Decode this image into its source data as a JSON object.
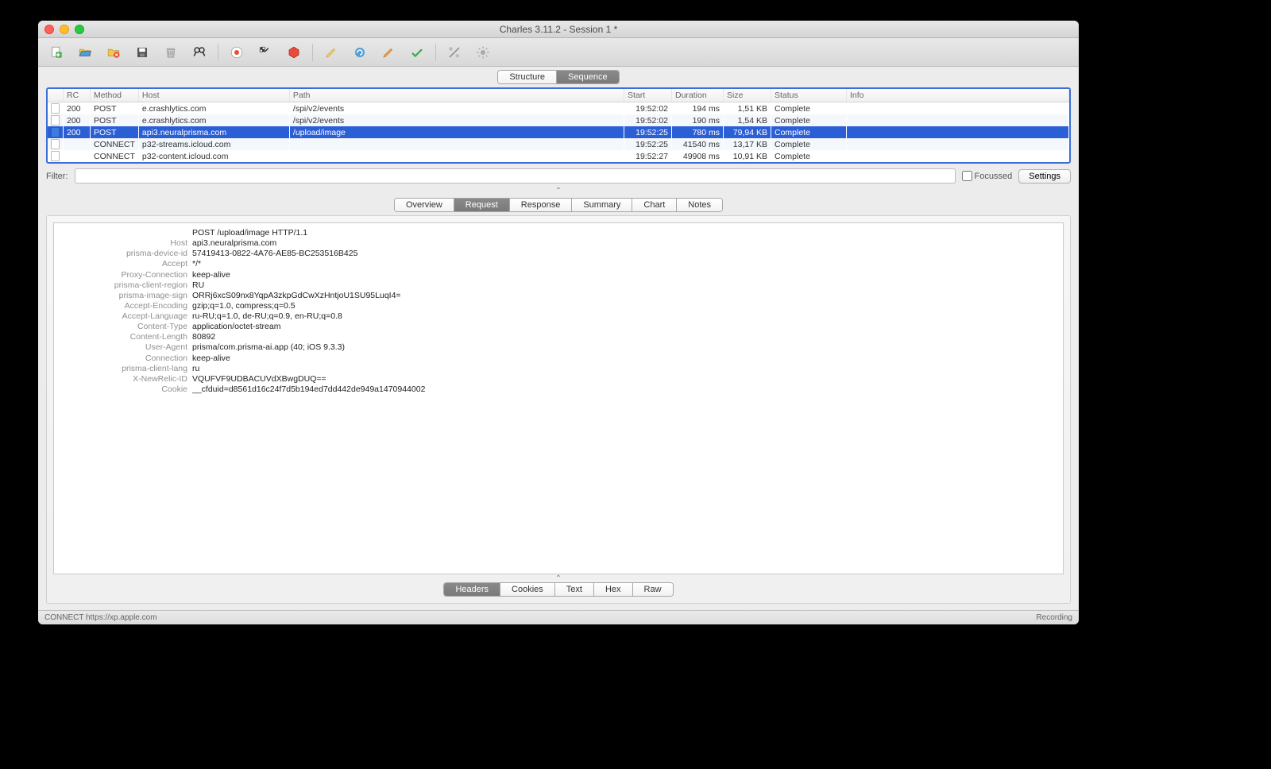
{
  "window": {
    "title": "Charles 3.11.2 - Session 1 *"
  },
  "view_tabs": {
    "structure": "Structure",
    "sequence": "Sequence",
    "active": "sequence"
  },
  "columns": [
    "",
    "RC",
    "Method",
    "Host",
    "Path",
    "Start",
    "Duration",
    "Size",
    "Status",
    "Info"
  ],
  "rows": [
    {
      "icon": "doc",
      "rc": "200",
      "method": "POST",
      "host": "e.crashlytics.com",
      "path": "/spi/v2/events",
      "start": "19:52:02",
      "duration": "194 ms",
      "size": "1,51 KB",
      "status": "Complete",
      "info": ""
    },
    {
      "icon": "doc",
      "rc": "200",
      "method": "POST",
      "host": "e.crashlytics.com",
      "path": "/spi/v2/events",
      "start": "19:52:02",
      "duration": "190 ms",
      "size": "1,54 KB",
      "status": "Complete",
      "info": ""
    },
    {
      "icon": "doc-blue",
      "rc": "200",
      "method": "POST",
      "host": "api3.neuralprisma.com",
      "path": "/upload/image",
      "start": "19:52:25",
      "duration": "780 ms",
      "size": "79,94 KB",
      "status": "Complete",
      "info": "",
      "selected": true
    },
    {
      "icon": "doc-white",
      "rc": "",
      "method": "CONNECT",
      "host": "p32-streams.icloud.com",
      "path": "",
      "start": "19:52:25",
      "duration": "41540 ms",
      "size": "13,17 KB",
      "status": "Complete",
      "info": ""
    },
    {
      "icon": "doc-white",
      "rc": "",
      "method": "CONNECT",
      "host": "p32-content.icloud.com",
      "path": "",
      "start": "19:52:27",
      "duration": "49908 ms",
      "size": "10,91 KB",
      "status": "Complete",
      "info": ""
    }
  ],
  "filter": {
    "label": "Filter:",
    "value": "",
    "focussed_label": "Focussed",
    "settings_label": "Settings"
  },
  "detail_tabs": {
    "overview": "Overview",
    "request": "Request",
    "response": "Response",
    "summary": "Summary",
    "chart": "Chart",
    "notes": "Notes",
    "active": "request"
  },
  "request_line": "POST /upload/image HTTP/1.1",
  "headers": [
    {
      "k": "Host",
      "v": "api3.neuralprisma.com"
    },
    {
      "k": "prisma-device-id",
      "v": "57419413-0822-4A76-AE85-BC253516B425"
    },
    {
      "k": "Accept",
      "v": "*/*"
    },
    {
      "k": "Proxy-Connection",
      "v": "keep-alive"
    },
    {
      "k": "prisma-client-region",
      "v": "RU"
    },
    {
      "k": "prisma-image-sign",
      "v": "ORRj6xcS09nx8YqpA3zkpGdCwXzHntjoU1SU95LuqI4="
    },
    {
      "k": "Accept-Encoding",
      "v": "gzip;q=1.0, compress;q=0.5"
    },
    {
      "k": "Accept-Language",
      "v": "ru-RU;q=1.0, de-RU;q=0.9, en-RU;q=0.8"
    },
    {
      "k": "Content-Type",
      "v": "application/octet-stream"
    },
    {
      "k": "Content-Length",
      "v": "80892"
    },
    {
      "k": "User-Agent",
      "v": "prisma/com.prisma-ai.app (40; iOS 9.3.3)"
    },
    {
      "k": "Connection",
      "v": "keep-alive"
    },
    {
      "k": "prisma-client-lang",
      "v": "ru"
    },
    {
      "k": "X-NewRelic-ID",
      "v": "VQUFVF9UDBACUVdXBwgDUQ=="
    },
    {
      "k": "Cookie",
      "v": "__cfduid=d8561d16c24f7d5b194ed7dd442de949a1470944002"
    }
  ],
  "body_tabs": {
    "headers": "Headers",
    "cookies": "Cookies",
    "text": "Text",
    "hex": "Hex",
    "raw": "Raw",
    "active": "headers"
  },
  "status": {
    "left": "CONNECT https://xp.apple.com",
    "right": "Recording"
  }
}
